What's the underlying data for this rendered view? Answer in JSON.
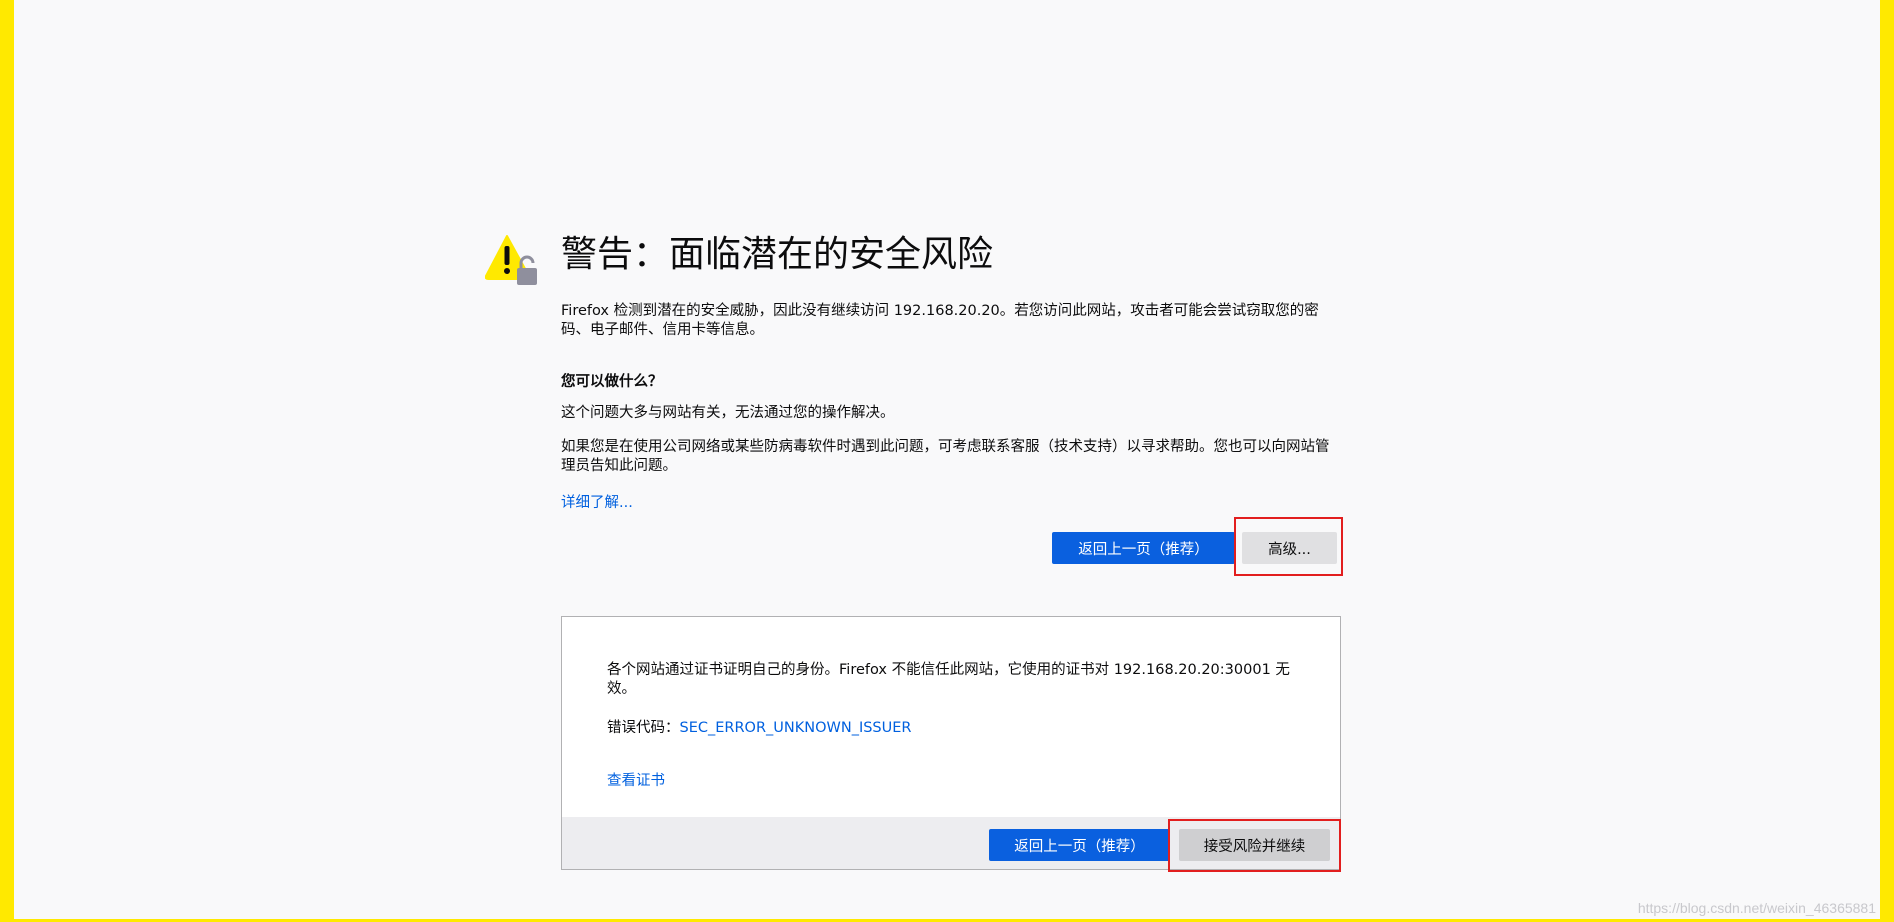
{
  "page": {
    "title": "警告：面临潜在的安全风险",
    "intro": "Firefox 检测到潜在的安全威胁，因此没有继续访问 192.168.20.20。若您访问此网站，攻击者可能会尝试窃取您的密码、电子邮件、信用卡等信息。",
    "what_heading": "您可以做什么？",
    "what_p1": "这个问题大多与网站有关，无法通过您的操作解决。",
    "what_p2": "如果您是在使用公司网络或某些防病毒软件时遇到此问题，可考虑联系客服（技术支持）以寻求帮助。您也可以向网站管理员告知此问题。",
    "learn_more": "详细了解..."
  },
  "buttons": {
    "go_back": "返回上一页（推荐）",
    "advanced": "高级...",
    "accept": "接受风险并继续"
  },
  "advanced_panel": {
    "description": "各个网站通过证书证明自己的身份。Firefox 不能信任此网站，它使用的证书对 192.168.20.20:30001 无效。",
    "error_code_label": "错误代码：",
    "error_code": "SEC_ERROR_UNKNOWN_ISSUER",
    "view_certificate": "查看证书"
  },
  "watermark": "https://blog.csdn.net/weixin_46365881",
  "colors": {
    "frame": "#ffe900",
    "primary": "#0a60df",
    "link": "#0060df",
    "highlight": "#e21e1e"
  },
  "icons": {
    "warning": "warning-triangle-lock-icon"
  }
}
